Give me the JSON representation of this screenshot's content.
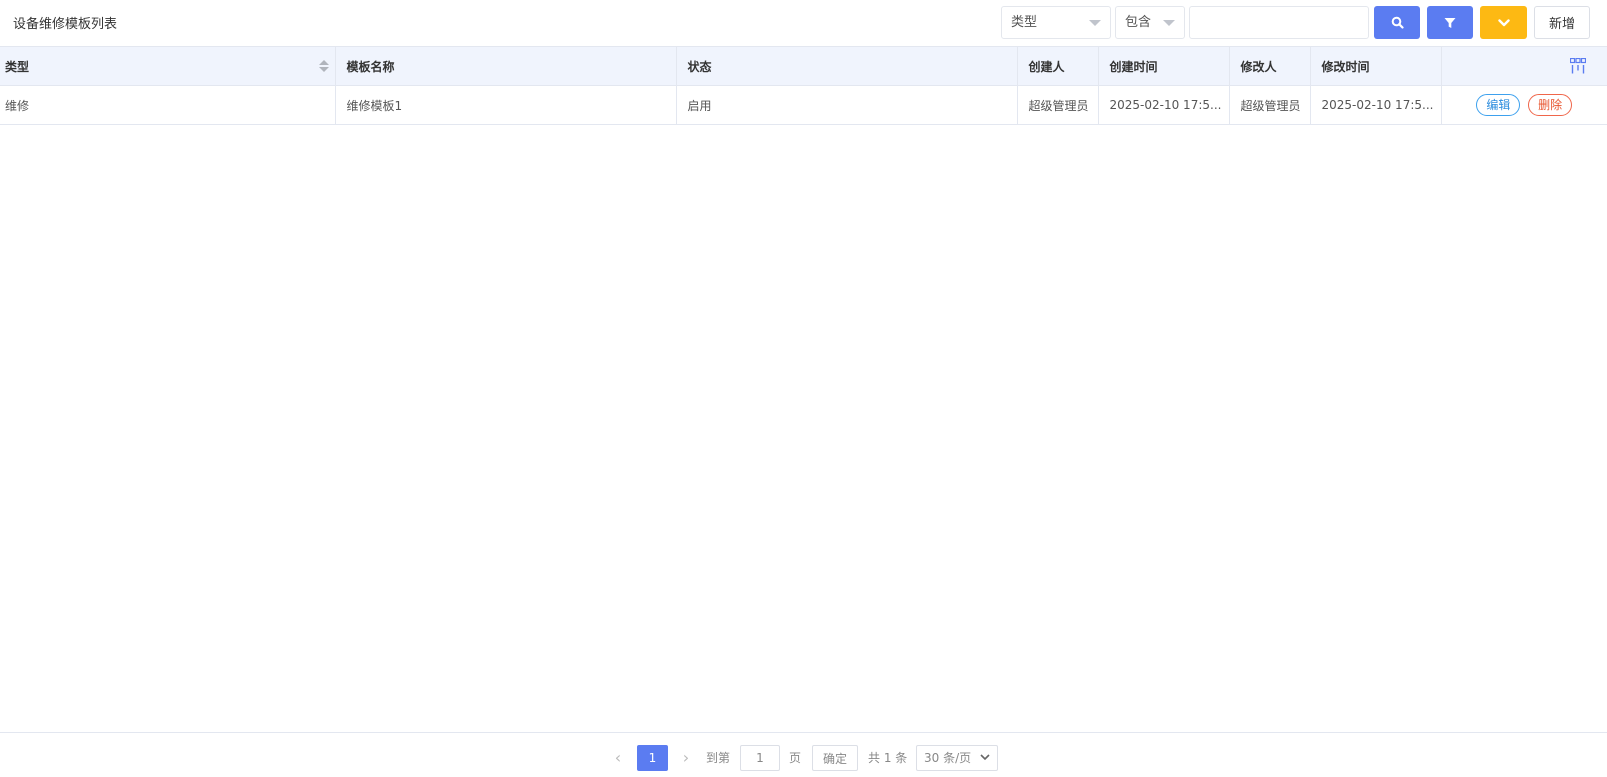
{
  "header": {
    "title": "设备维修模板列表",
    "type_select": "类型",
    "condition_select": "包含",
    "search_value": "",
    "add_label": "新增"
  },
  "icons": {
    "search": "search-icon",
    "filter": "filter-icon",
    "more": "chevron-down-icon",
    "columns": "column-settings-icon"
  },
  "colors": {
    "primary": "#5b7cf1",
    "warning": "#fdb913",
    "edit": "#2f8ede",
    "delete": "#e8542f",
    "header_bg": "#f0f4fd"
  },
  "table": {
    "columns": [
      "类型",
      "模板名称",
      "状态",
      "创建人",
      "创建时间",
      "修改人",
      "修改时间"
    ],
    "rows": [
      {
        "type": "维修",
        "name": "维修模板1",
        "status": "启用",
        "creator": "超级管理员",
        "created_at": "2025-02-10 17:5...",
        "modifier": "超级管理员",
        "modified_at": "2025-02-10 17:5...",
        "edit_label": "编辑",
        "delete_label": "删除"
      }
    ]
  },
  "pager": {
    "current": "1",
    "goto_label": "到第",
    "goto_value": "1",
    "page_label": "页",
    "confirm_label": "确定",
    "total_label": "共 1 条",
    "page_size": "30 条/页"
  }
}
